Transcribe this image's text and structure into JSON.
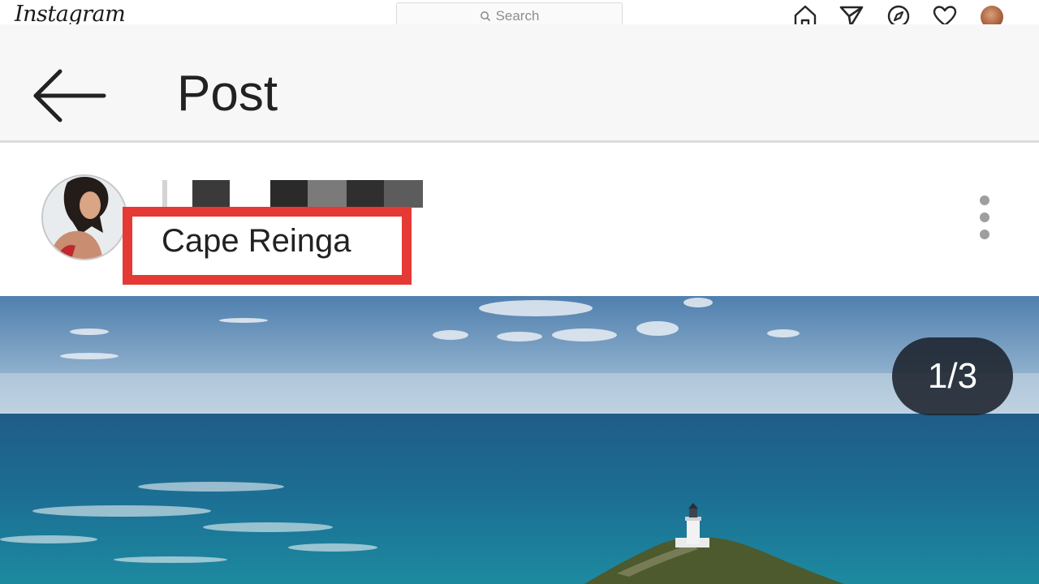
{
  "topnav": {
    "logo_text": "Instagram",
    "search_placeholder": "Search",
    "icons": [
      "home-icon",
      "direct-send-icon",
      "explore-compass-icon",
      "activity-heart-icon",
      "profile-avatar"
    ]
  },
  "header": {
    "title": "Post",
    "back_icon": "arrow-left-icon"
  },
  "post": {
    "location": "Cape Reinga",
    "username_redacted": true,
    "highlight_color": "#e53935",
    "more_icon": "more-vertical-icon"
  },
  "media": {
    "counter": "1/3",
    "subject": "lighthouse-on-headland-by-ocean"
  }
}
